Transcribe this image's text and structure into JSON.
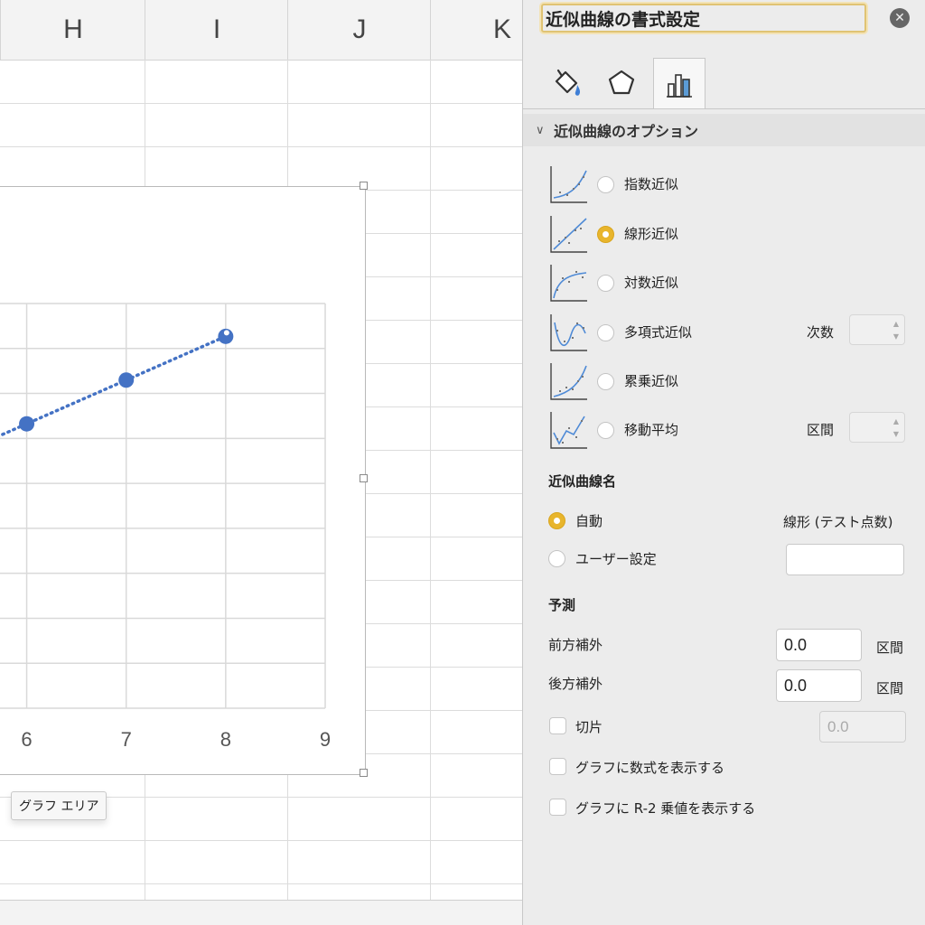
{
  "sheet": {
    "columns": [
      "H",
      "I",
      "J",
      "K"
    ],
    "chart": {
      "tooltip": "グラフ エリア"
    }
  },
  "chart_data": {
    "type": "scatter",
    "x_ticks": [
      "6",
      "7",
      "8",
      "9"
    ],
    "xlim": [
      5.65,
      9
    ],
    "series": [
      {
        "x": [
          6,
          7,
          8
        ],
        "y": [
          8.3,
          8.5,
          8.7
        ],
        "color": "#4472c4"
      }
    ],
    "trendline": {
      "type": "linear",
      "style": "dotted",
      "color": "#4472c4"
    },
    "grid": true
  },
  "pane": {
    "title": "近似曲線の書式設定",
    "close_icon": "close-icon",
    "tabs": [
      {
        "icon": "fill-icon",
        "active": false
      },
      {
        "icon": "pentagon-effects-icon",
        "active": false
      },
      {
        "icon": "bar-chart-options-icon",
        "active": true
      }
    ],
    "section_title": "近似曲線のオプション",
    "trend_types": [
      {
        "label": "指数近似",
        "icon": "exponential-icon",
        "selected": false
      },
      {
        "label": "線形近似",
        "icon": "linear-icon",
        "selected": true
      },
      {
        "label": "対数近似",
        "icon": "logarithmic-icon",
        "selected": false
      },
      {
        "label": "多項式近似",
        "icon": "polynomial-icon",
        "selected": false,
        "param_label": "次数"
      },
      {
        "label": "累乗近似",
        "icon": "power-icon",
        "selected": false
      },
      {
        "label": "移動平均",
        "icon": "moving-average-icon",
        "selected": false,
        "param_label": "区間"
      }
    ],
    "name_section": {
      "title": "近似曲線名",
      "auto_label": "自動",
      "auto_value": "線形 (テスト点数)",
      "custom_label": "ユーザー設定",
      "custom_value": ""
    },
    "forecast": {
      "title": "予測",
      "forward_label": "前方補外",
      "forward_value": "0.0",
      "backward_label": "後方補外",
      "backward_value": "0.0",
      "unit": "区間",
      "intercept_label": "切片",
      "intercept_value": "0.0"
    },
    "display_equation_label": "グラフに数式を表示する",
    "display_r2_label": "グラフに R-2 乗値を表示する"
  }
}
